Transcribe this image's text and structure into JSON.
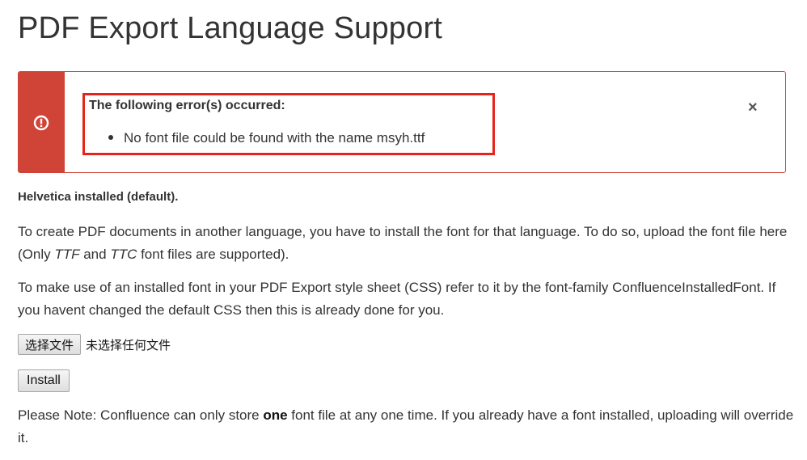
{
  "page": {
    "title": "PDF Export Language Support"
  },
  "error": {
    "heading": "The following error(s) occurred:",
    "items": [
      "No font file could be found with the name msyh.ttf"
    ],
    "close_label": "×",
    "accent_color": "#d04437",
    "highlight_color": "#e8231b",
    "icon": "exclamation-circle-icon"
  },
  "font_status": "Helvetica installed (default).",
  "instructions": {
    "p1_before": "To create PDF documents in another language, you have to install the font for that language. To do so, upload the font file here (Only ",
    "p1_ttf": "TTF",
    "p1_and": " and ",
    "p1_ttc": "TTC",
    "p1_after": " font files are supported).",
    "p2": "To make use of an installed font in your PDF Export style sheet (CSS) refer to it by the font-family ConfluenceInstalledFont. If you havent changed the default CSS then this is already done for you."
  },
  "file_input": {
    "button_label": "选择文件",
    "status": "未选择任何文件"
  },
  "install": {
    "label": "Install"
  },
  "note": {
    "before": "Please Note: Confluence can only store ",
    "bold": "one",
    "after": " font file at any one time. If you already have a font installed, uploading will override it."
  }
}
